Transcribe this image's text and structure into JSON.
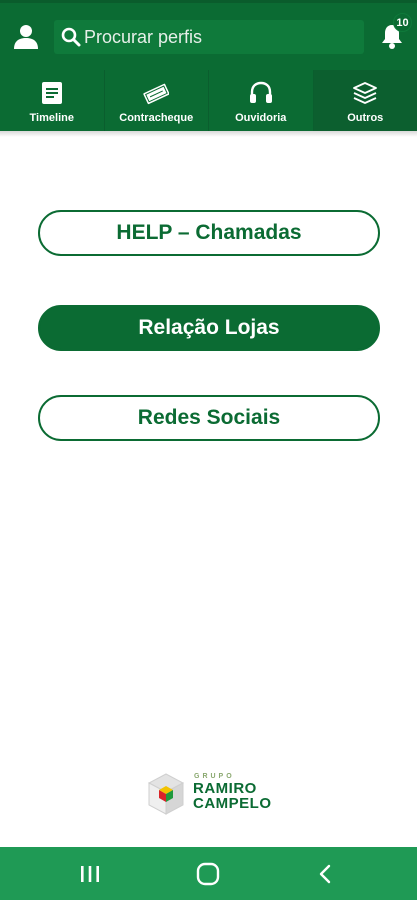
{
  "header": {
    "search_placeholder": "Procurar perfis",
    "notification_count": "10"
  },
  "tabs": [
    {
      "label": "Timeline",
      "icon": "document-icon"
    },
    {
      "label": "Contracheque",
      "icon": "ticket-icon"
    },
    {
      "label": "Ouvidoria",
      "icon": "headset-icon"
    },
    {
      "label": "Outros",
      "icon": "layers-icon",
      "active": true
    }
  ],
  "menu": {
    "help_label": "HELP – Chamadas",
    "lojas_label": "Relação Lojas",
    "redes_label": "Redes Sociais"
  },
  "logo": {
    "grupo": "GRUPO",
    "ramiro": "RAMIRO",
    "campelo": "CAMPELO"
  },
  "colors": {
    "primary_green": "#0b6b33",
    "navbar_green": "#1f9a55"
  }
}
